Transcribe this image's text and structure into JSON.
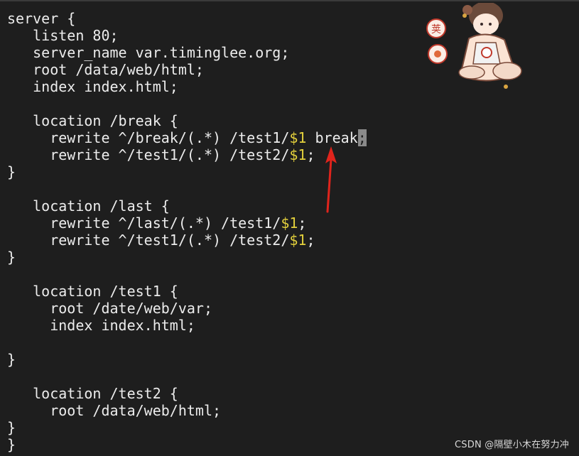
{
  "code": {
    "lines": [
      [
        {
          "t": "server {"
        }
      ],
      [
        {
          "t": "   listen 80;"
        }
      ],
      [
        {
          "t": "   server_name var.timinglee.org;"
        }
      ],
      [
        {
          "t": "   root /data/web/html;"
        }
      ],
      [
        {
          "t": "   index index.html;"
        }
      ],
      [
        {
          "t": ""
        }
      ],
      [
        {
          "t": "   location /break {"
        }
      ],
      [
        {
          "t": "     rewrite ^/break/(.*) /test1/"
        },
        {
          "t": "$1",
          "c": "var"
        },
        {
          "t": " break"
        },
        {
          "t": ";",
          "c": "cursor"
        }
      ],
      [
        {
          "t": "     rewrite ^/test1/(.*) /test2/"
        },
        {
          "t": "$1",
          "c": "var"
        },
        {
          "t": ";"
        }
      ],
      [
        {
          "t": "}"
        }
      ],
      [
        {
          "t": ""
        }
      ],
      [
        {
          "t": "   location /last {"
        }
      ],
      [
        {
          "t": "     rewrite ^/last/(.*) /test1/"
        },
        {
          "t": "$1",
          "c": "var"
        },
        {
          "t": ";"
        }
      ],
      [
        {
          "t": "     rewrite ^/test1/(.*) /test2/"
        },
        {
          "t": "$1",
          "c": "var"
        },
        {
          "t": ";"
        }
      ],
      [
        {
          "t": "}"
        }
      ],
      [
        {
          "t": ""
        }
      ],
      [
        {
          "t": "   location /test1 {"
        }
      ],
      [
        {
          "t": "     root /date/web/var;"
        }
      ],
      [
        {
          "t": "     index index.html;"
        }
      ],
      [
        {
          "t": ""
        }
      ],
      [
        {
          "t": "}"
        }
      ],
      [
        {
          "t": ""
        }
      ],
      [
        {
          "t": "   location /test2 {"
        }
      ],
      [
        {
          "t": "     root /data/web/html;"
        }
      ],
      [
        {
          "t": "}"
        }
      ],
      [
        {
          "t": "}"
        }
      ]
    ]
  },
  "watermark": "CSDN @隔壁小木在努力冲",
  "mascot": {
    "badge_top_text": "荚",
    "badge_bottom_text": "",
    "icon": "anime-girl-sticker"
  },
  "annotation": {
    "icon": "red-arrow-up-icon",
    "color": "#e0241c"
  },
  "colors": {
    "background": "#1e1e1e",
    "text": "#ececec",
    "variable": "#e3d03c",
    "cursor": "#8a8a8a"
  }
}
